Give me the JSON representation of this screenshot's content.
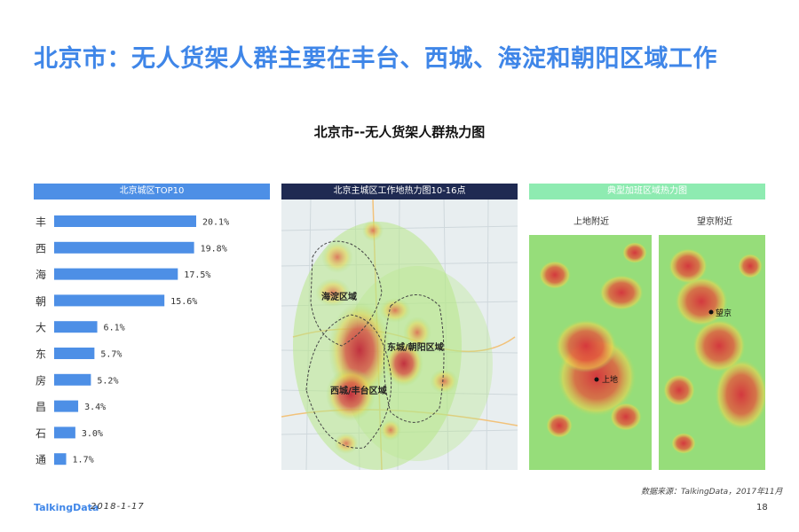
{
  "title": "北京市：无人货架人群主要在丰台、西城、海淀和朝阳区域工作",
  "subtitle": "北京市--无人货架人群热力图",
  "panels": {
    "left_header": "北京城区TOP10",
    "mid_header": "北京主城区工作地热力图10-16点",
    "right_header": "典型加班区域热力图"
  },
  "mid_labels": {
    "haidian": "海淀区域",
    "dongcheng": "东城/朝阳区域",
    "xicheng": "西城/丰台区域"
  },
  "right_labels": {
    "left_title": "上地附近",
    "right_title": "望京附近",
    "pin1": "上地",
    "pin2": "望京"
  },
  "chart_data": {
    "type": "bar",
    "orientation": "horizontal",
    "title": "北京城区TOP10",
    "categories": [
      "丰",
      "西",
      "海",
      "朝",
      "大",
      "东",
      "房",
      "昌",
      "石",
      "通"
    ],
    "values": [
      20.1,
      19.8,
      17.5,
      15.6,
      6.1,
      5.7,
      5.2,
      3.4,
      3.0,
      1.7
    ],
    "value_labels": [
      "20.1%",
      "19.8%",
      "17.5%",
      "15.6%",
      "6.1%",
      "5.7%",
      "5.2%",
      "3.4%",
      "3.0%",
      "1.7%"
    ],
    "bar_color": "#4d8fe6"
  },
  "footer": {
    "logo": "TalkingData",
    "date": "2018-1-17",
    "source": "数据来源：TalkingData，2017年11月",
    "page": "18"
  }
}
